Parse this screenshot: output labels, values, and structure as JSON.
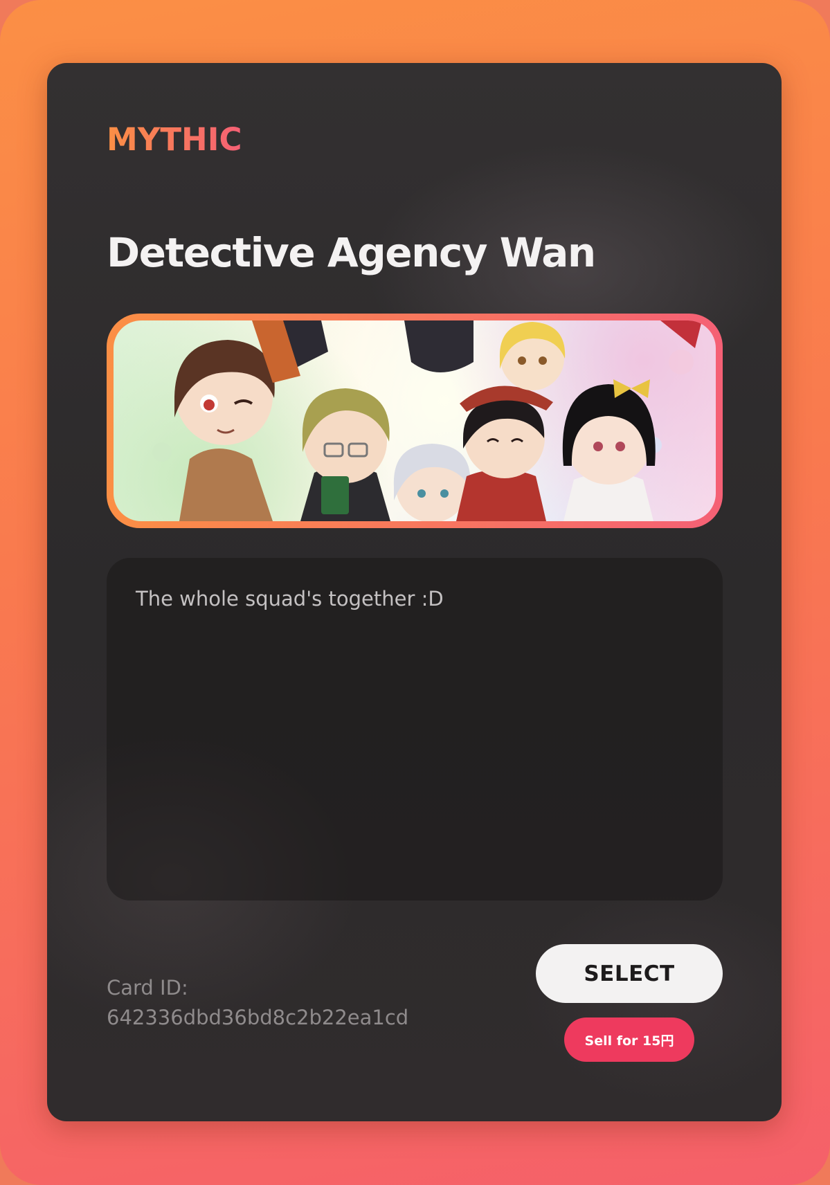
{
  "card": {
    "rarity": "MYTHIC",
    "title": "Detective Agency Wan",
    "image_icon": "anime-group-illustration",
    "description": "The whole squad's together :D",
    "id_label": "Card ID:",
    "id_value": "642336dbd36bd8c2b22ea1cd",
    "select_label": "SELECT",
    "sell_label": "Sell for 15円"
  },
  "colors": {
    "border_gradient_start": "#fb8f45",
    "border_gradient_end": "#f5606a",
    "card_background": "#2e2b2c",
    "sell_button": "#ee3a5e",
    "select_button": "#f3f2f2"
  }
}
